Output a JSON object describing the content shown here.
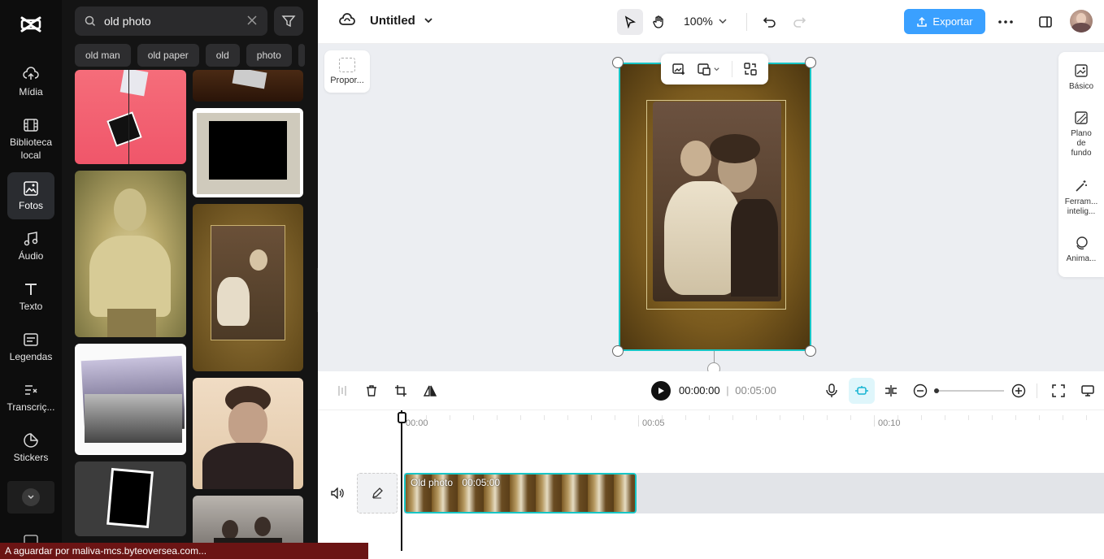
{
  "rail": {
    "items": [
      {
        "label": "Mídia",
        "icon": "cloud-upload-icon"
      },
      {
        "label": "Biblioteca local",
        "icon": "film-icon"
      },
      {
        "label": "Fotos",
        "icon": "image-icon"
      },
      {
        "label": "Áudio",
        "icon": "music-icon"
      },
      {
        "label": "Texto",
        "icon": "text-icon"
      },
      {
        "label": "Legendas",
        "icon": "captions-icon"
      },
      {
        "label": "Transcriç...",
        "icon": "transcript-icon"
      },
      {
        "label": "Stickers",
        "icon": "sticker-icon"
      }
    ],
    "active": "Fotos"
  },
  "search": {
    "value": "old photo",
    "chips": [
      "old man",
      "old paper",
      "old",
      "photo"
    ]
  },
  "topbar": {
    "project_name": "Untitled",
    "zoom": "100%",
    "export_label": "Exportar"
  },
  "canvas": {
    "ratio_label": "Propor..."
  },
  "right_panel": {
    "items": [
      {
        "label": "Básico",
        "icon": "basic-icon"
      },
      {
        "label": "Plano de fundo",
        "icon": "background-icon"
      },
      {
        "label": "Ferram... intelig...",
        "icon": "magic-wand-icon"
      },
      {
        "label": "Anima...",
        "icon": "animation-icon"
      }
    ]
  },
  "timeline": {
    "current_time": "00:00:00",
    "total_time": "00:05:00",
    "ruler": [
      "00:00",
      "00:05",
      "00:10"
    ],
    "clip_name": "Old photo",
    "clip_duration": "00:05:00"
  },
  "status": "A aguardar por maliva-mcs.byteoversea.com..."
}
